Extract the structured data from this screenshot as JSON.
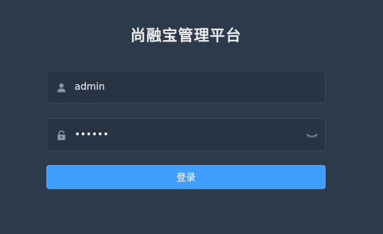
{
  "title": "尚融宝管理平台",
  "username": {
    "value": "admin",
    "icon": "user-icon"
  },
  "password": {
    "value": "123456",
    "icon": "lock-icon",
    "toggle_icon": "eye-closed-icon"
  },
  "login_button_label": "登录",
  "colors": {
    "background": "#2d3a4b",
    "field_background": "#283443",
    "accent": "#409eff",
    "icon": "#889aa4"
  }
}
